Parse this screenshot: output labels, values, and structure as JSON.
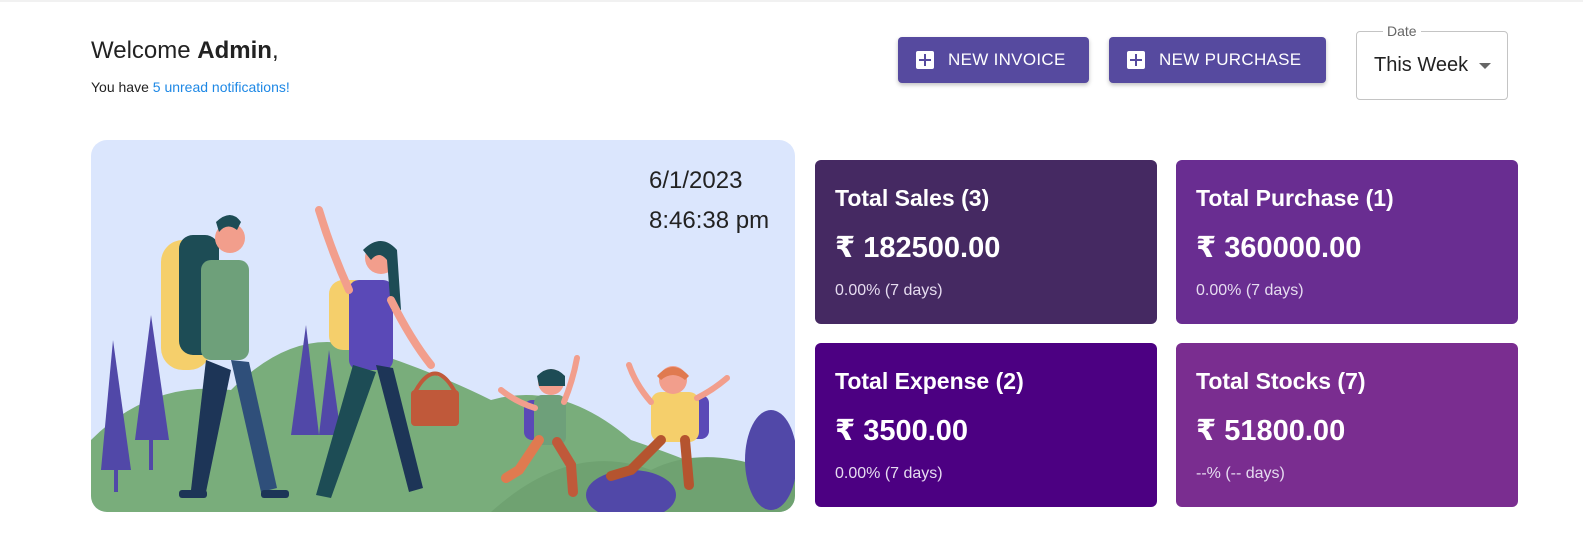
{
  "header": {
    "welcome_prefix": "Welcome ",
    "user_name": "Admin",
    "welcome_suffix": ",",
    "notif_prefix": "You have ",
    "notif_link": "5 unread notifications!"
  },
  "actions": {
    "new_invoice_label": "NEW INVOICE",
    "new_purchase_label": "NEW PURCHASE",
    "icon": "plus-box-icon"
  },
  "date_filter": {
    "label": "Date",
    "value": "This Week"
  },
  "hero": {
    "date": "6/1/2023",
    "time": "8:46:38 pm",
    "colors": {
      "background": "#dbe6fd",
      "hill": "#79ad7b",
      "tree": "#5148a8"
    }
  },
  "cards": [
    {
      "title": "Total Sales (3)",
      "value": "₹ 182500.00",
      "change": "0.00% (7 days)",
      "color": "#452962"
    },
    {
      "title": "Total Purchase (1)",
      "value": "₹ 360000.00",
      "change": "0.00% (7 days)",
      "color": "#692d91"
    },
    {
      "title": "Total Expense (2)",
      "value": "₹ 3500.00",
      "change": "0.00% (7 days)",
      "color": "#4c0082"
    },
    {
      "title": "Total Stocks (7)",
      "value": "₹ 51800.00",
      "change": "--% (-- days)",
      "color": "#7a2d90"
    }
  ],
  "colors": {
    "accent": "#564a9f",
    "link": "#1e88e5"
  }
}
